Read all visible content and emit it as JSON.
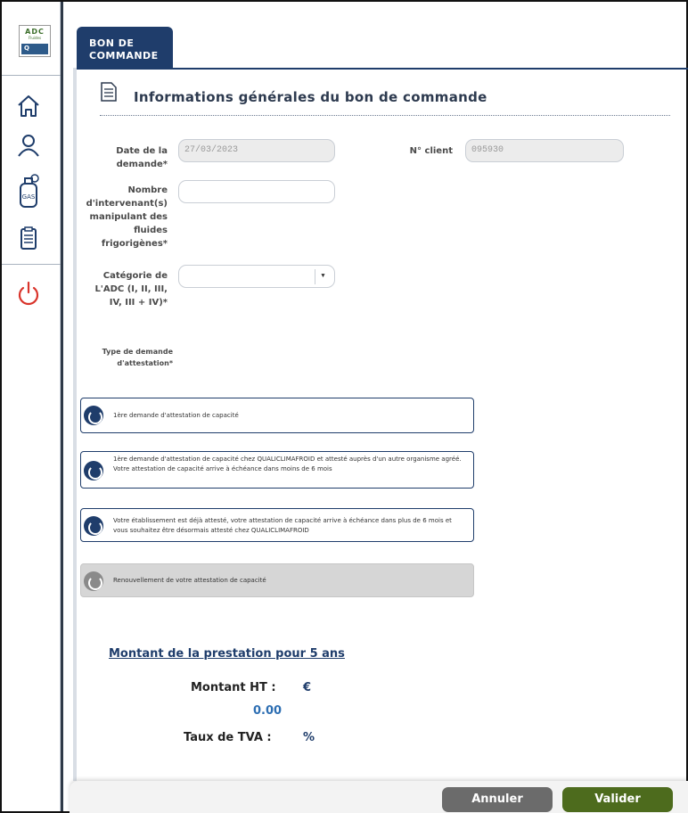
{
  "logo": {
    "line1": "ADC",
    "line2": "Fluides",
    "line3": "Q"
  },
  "tab": {
    "label": "BON DE\nCOMMANDE"
  },
  "section": {
    "title": "Informations générales du bon de commande"
  },
  "form": {
    "date_label": "Date de la demande*",
    "date_value": "27/03/2023",
    "client_label": "N° client",
    "client_value": "095930",
    "nb_label": "Nombre d'intervenant(s) manipulant des fluides frigorigènes*",
    "nb_value": "",
    "category_label": "Catégorie de L'ADC (I, II, III, IV, III + IV)*",
    "category_value": "",
    "type_label": "Type de demande d'attestation*"
  },
  "options": [
    {
      "text": "1ère demande d'attestation de capacité",
      "disabled": false
    },
    {
      "text": "1ère demande d'attestation de capacité chez QUALICLIMAFROID et attesté auprès d'un autre organisme agréé. Votre attestation de capacité arrive à échéance dans moins de 6 mois",
      "disabled": false
    },
    {
      "text": "Votre établissement est déjà attesté, votre attestation de capacité arrive à échéance dans plus de 6 mois et vous souhaitez être désormais attesté chez QUALICLIMAFROID",
      "disabled": false
    },
    {
      "text": "Renouvellement de votre attestation de capacité",
      "disabled": true
    }
  ],
  "amount": {
    "title": "Montant de la prestation pour 5 ans",
    "ht_label": "Montant HT :",
    "ht_unit": "€",
    "ht_value": "0.00",
    "tva_label": "Taux de TVA :",
    "tva_unit": "%"
  },
  "footer": {
    "cancel_label": "Annuler",
    "validate_label": "Valider"
  },
  "colors": {
    "navy": "#1f3d6b",
    "validate": "#4d6b1d",
    "cancel": "#6b6b6b",
    "power": "#d9342b"
  },
  "icons": [
    "home-icon",
    "user-icon",
    "gas-bottle-icon",
    "clipboard-icon",
    "power-icon",
    "document-icon",
    "chevron-down-icon",
    "radio-icon"
  ]
}
